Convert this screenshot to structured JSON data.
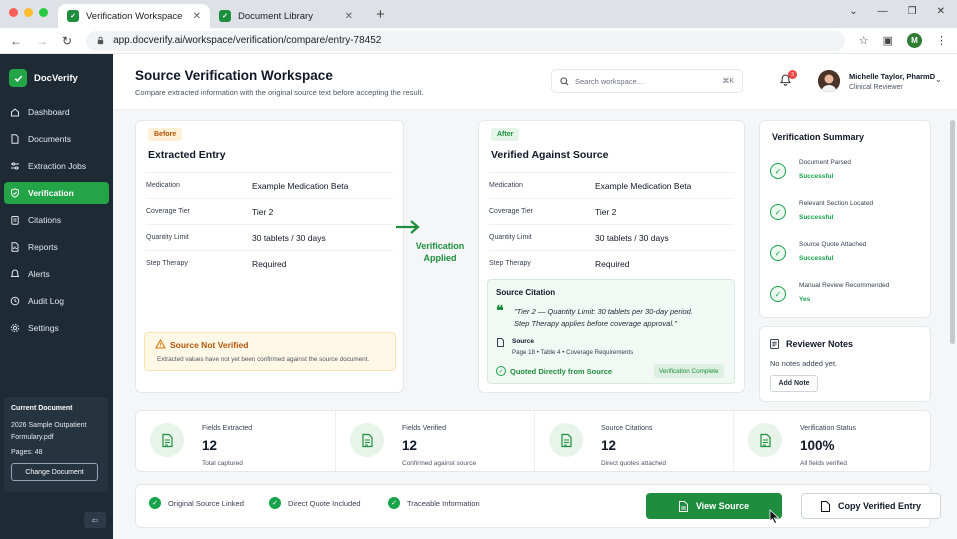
{
  "browser": {
    "tabs": [
      {
        "title": "Verification Workspace"
      },
      {
        "title": "Document Library"
      }
    ],
    "url": "app.docverify.ai/workspace/verification/compare/entry-78452",
    "profile_initial": "M"
  },
  "app": {
    "name": "DocVerify",
    "nav": [
      {
        "label": "Dashboard",
        "icon": "home-icon"
      },
      {
        "label": "Documents",
        "icon": "document-icon"
      },
      {
        "label": "Extraction Jobs",
        "icon": "sliders-icon"
      },
      {
        "label": "Verification",
        "icon": "shield-check-icon",
        "active": true
      },
      {
        "label": "Citations",
        "icon": "clipboard-icon"
      },
      {
        "label": "Reports",
        "icon": "report-icon"
      },
      {
        "label": "Alerts",
        "icon": "bell-icon"
      },
      {
        "label": "Audit Log",
        "icon": "history-icon"
      },
      {
        "label": "Settings",
        "icon": "gear-icon"
      }
    ],
    "current_document": {
      "title": "Current Document",
      "filename": "2026 Sample Outpatient Formulary.pdf",
      "pages": "Pages: 48",
      "button": "Change Document"
    }
  },
  "header": {
    "title": "Source Verification Workspace",
    "subtitle": "Compare extracted information with the original source text before accepting the result.",
    "search_placeholder": "Search workspace...",
    "search_shortcut": "⌘K",
    "notifications": "3",
    "user_name": "Michelle Taylor, PharmD",
    "user_role": "Clinical Reviewer"
  },
  "before": {
    "pill": "Before",
    "title": "Extracted Entry",
    "fields": [
      {
        "label": "Medication",
        "value": "Example Medication Beta"
      },
      {
        "label": "Coverage Tier",
        "value": "Tier 2"
      },
      {
        "label": "Quantity Limit",
        "value": "30 tablets / 30 days"
      },
      {
        "label": "Step Therapy",
        "value": "Required"
      }
    ],
    "warning_title": "Source Not Verified",
    "warning_text": "Extracted values have not yet been confirmed against the source document."
  },
  "transition": {
    "label_line1": "Verification",
    "label_line2": "Applied"
  },
  "after": {
    "pill": "After",
    "title": "Verified Against Source",
    "fields": [
      {
        "label": "Medication",
        "value": "Example Medication Beta"
      },
      {
        "label": "Coverage Tier",
        "value": "Tier 2"
      },
      {
        "label": "Quantity Limit",
        "value": "30 tablets / 30 days"
      },
      {
        "label": "Step Therapy",
        "value": "Required"
      }
    ],
    "citation": {
      "title": "Source Citation",
      "quote_line1": "\"Tier 2 — Quantity Limit: 30 tablets per 30-day period.",
      "quote_line2": "Step Therapy applies before coverage approval.\"",
      "source_label": "Source",
      "source_detail": "Page 18  •  Table 4  •  Coverage Requirements",
      "quoted": "Quoted Directly from Source",
      "status": "Verification Complete"
    }
  },
  "summary": {
    "title": "Verification Summary",
    "items": [
      {
        "label": "Document Parsed",
        "status": "Successful"
      },
      {
        "label": "Relevant Section Located",
        "status": "Successful"
      },
      {
        "label": "Source Quote Attached",
        "status": "Successful"
      },
      {
        "label": "Manual Review Recommended",
        "status": "Yes"
      }
    ]
  },
  "notes": {
    "title": "Reviewer Notes",
    "empty": "No notes added yet.",
    "button": "Add Note"
  },
  "stats": [
    {
      "label": "Fields Extracted",
      "value": "12",
      "sub": "Total captured"
    },
    {
      "label": "Fields Verified",
      "value": "12",
      "sub": "Confirmed against source"
    },
    {
      "label": "Source Citations",
      "value": "12",
      "sub": "Direct quotes attached"
    },
    {
      "label": "Verification Status",
      "value": "100%",
      "sub": "All fields verified"
    }
  ],
  "footer": {
    "checks": [
      "Original Source Linked",
      "Direct Quote Included",
      "Traceable Information"
    ],
    "primary_button": "View Source",
    "secondary_button": "Copy Verified Entry"
  },
  "colors": {
    "accent": "#1e8e3e",
    "sidebar": "#1e2a34",
    "warning": "#b45309"
  }
}
